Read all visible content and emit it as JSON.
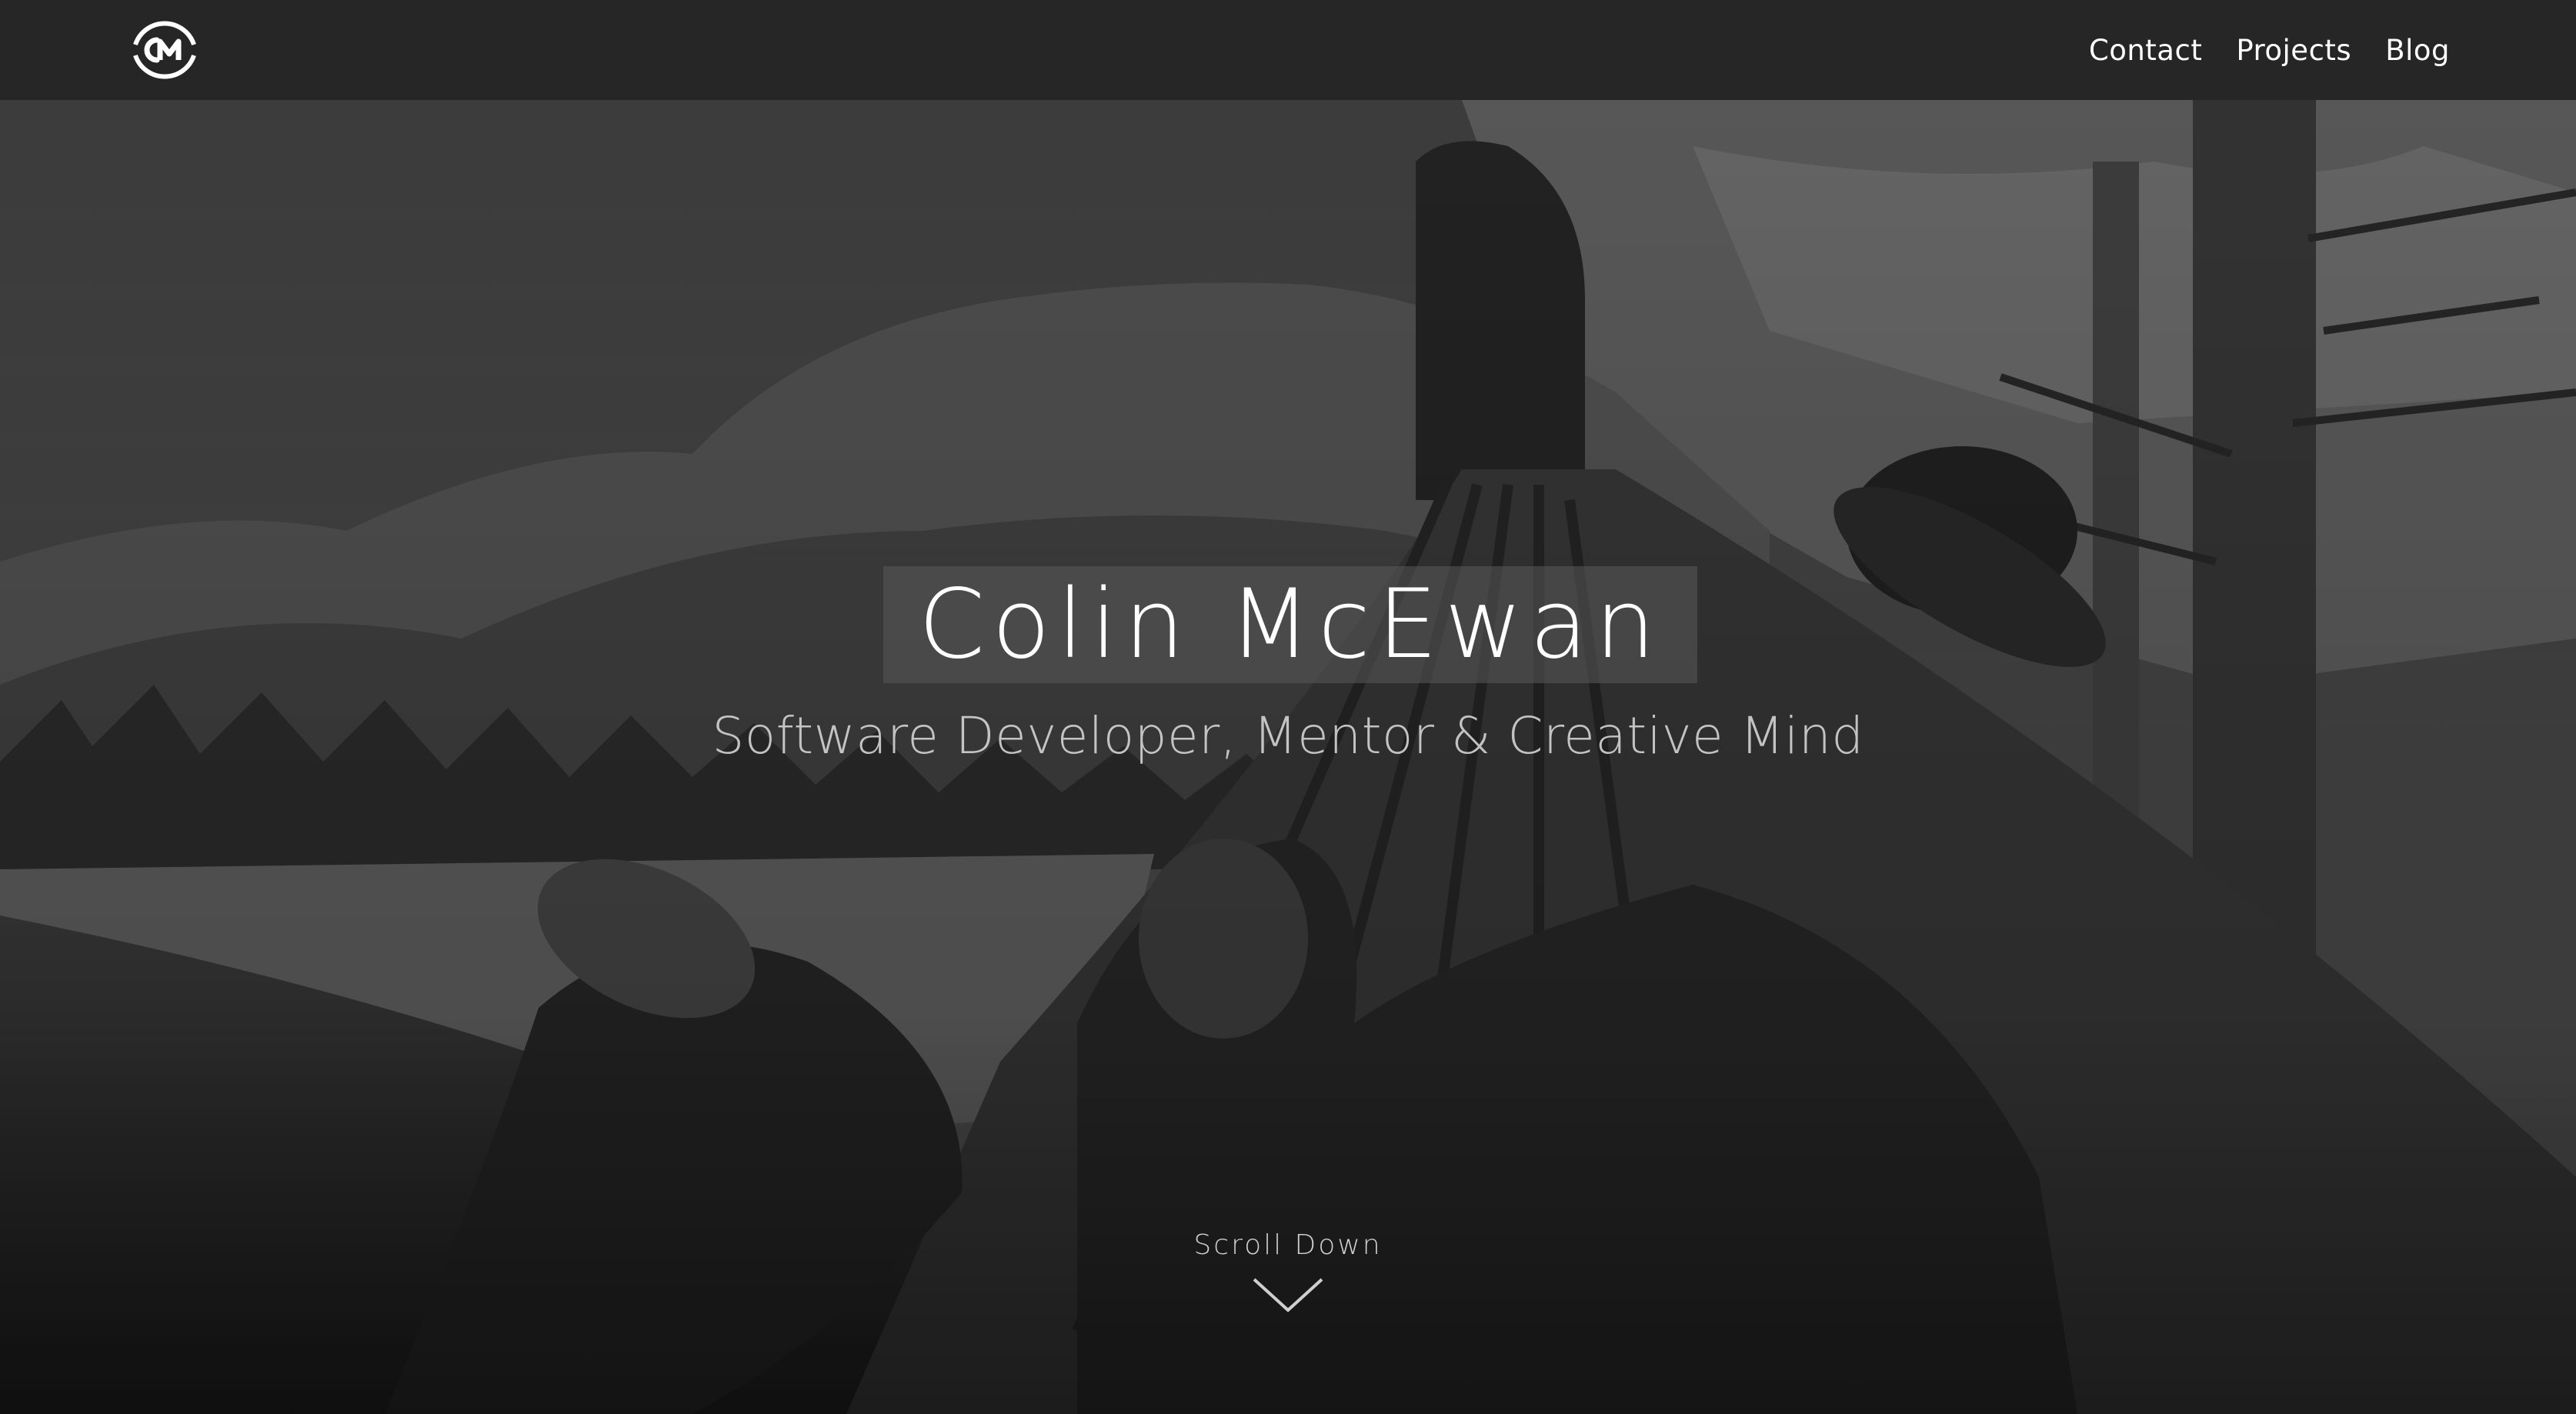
{
  "header": {
    "logo_alt": "CM",
    "nav": [
      {
        "label": "Contact"
      },
      {
        "label": "Projects"
      },
      {
        "label": "Blog"
      }
    ]
  },
  "hero": {
    "title": "Colin McEwan",
    "subtitle": "Software Developer, Mentor & Creative Mind",
    "scroll_label": "Scroll Down",
    "background_icon": "hammock-mountain-photo",
    "scroll_icon": "chevron-down-icon"
  },
  "colors": {
    "navbar": "#262626",
    "text": "#ffffff",
    "title_box": "#5a5a5a"
  }
}
